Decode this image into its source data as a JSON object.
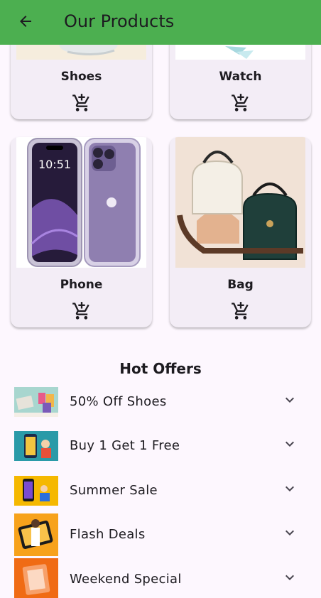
{
  "appbar": {
    "title": "Our Products",
    "back_icon": "arrow-back-icon",
    "color": "#4caf50"
  },
  "products": [
    {
      "name": "Shoes",
      "icon": "add-shopping-cart-icon"
    },
    {
      "name": "Watch",
      "icon": "add-shopping-cart-icon"
    },
    {
      "name": "Phone",
      "icon": "add-shopping-cart-icon"
    },
    {
      "name": "Bag",
      "icon": "add-shopping-cart-icon"
    }
  ],
  "hot_offers": {
    "title": "Hot Offers",
    "items": [
      {
        "label": "50% Off Shoes",
        "icon": "expand-more-icon"
      },
      {
        "label": "Buy 1 Get 1 Free",
        "icon": "expand-more-icon"
      },
      {
        "label": "Summer Sale",
        "icon": "expand-more-icon"
      },
      {
        "label": "Flash Deals",
        "icon": "expand-more-icon"
      },
      {
        "label": "Weekend Special",
        "icon": "expand-more-icon"
      }
    ]
  },
  "colors": {
    "background": "#fdf7fe",
    "card": "#f3edf6",
    "text": "#1d1b20"
  }
}
